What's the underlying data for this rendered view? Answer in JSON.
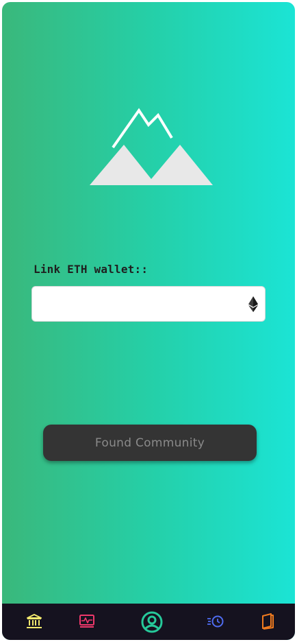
{
  "wallet": {
    "label": "Link ETH wallet::",
    "value": "",
    "placeholder": "",
    "currency_icon": "ethereum-icon"
  },
  "actions": {
    "found_community_label": "Found Community"
  },
  "logo": {
    "icon": "mountain-logo-icon"
  },
  "tabbar": {
    "items": [
      {
        "icon": "bank-icon",
        "color": "#f2e86d"
      },
      {
        "icon": "activity-chart-icon",
        "color": "#f0386b"
      },
      {
        "icon": "user-profile-icon",
        "color": "#26c99a"
      },
      {
        "icon": "history-clock-icon",
        "color": "#4f6cf0"
      },
      {
        "icon": "book-icon",
        "color": "#f07b1f"
      }
    ]
  },
  "colors": {
    "gradient_start": "#3ab87b",
    "gradient_end": "#1be4d5",
    "button_bg": "#343434",
    "button_text": "#8a8a8a",
    "tabbar_bg": "#15121f"
  }
}
